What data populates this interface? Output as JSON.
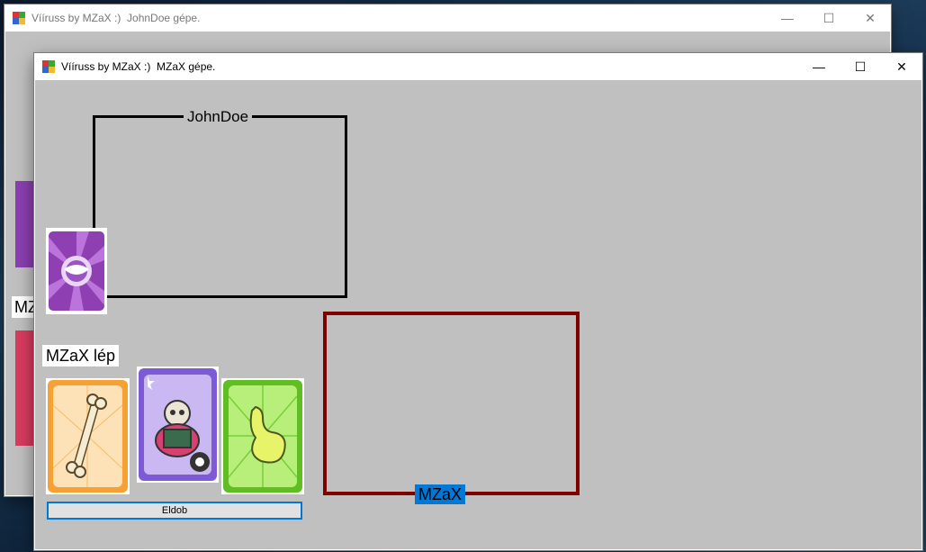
{
  "background_window": {
    "title": "Vííruss by MZaX :)  JohnDoe gépe.",
    "partial_label": "MZ"
  },
  "main_window": {
    "title": "Vííruss by MZaX :)  MZaX gépe.",
    "controls": {
      "minimize": "—",
      "maximize": "☐",
      "close": "✕"
    },
    "opponent": {
      "name": "JohnDoe",
      "deck_card": "virus-card-back"
    },
    "player": {
      "turn_label": "MZaX lép",
      "hand": [
        {
          "name": "bone-organ-card",
          "color": "#f7a033"
        },
        {
          "name": "virus-skeleton-card",
          "color": "#7e5bd6"
        },
        {
          "name": "stomach-organ-card",
          "color": "#6fcf2b"
        }
      ],
      "discard_button": "Eldob"
    },
    "table": {
      "name": "MZaX",
      "border_color": "#800000"
    }
  }
}
